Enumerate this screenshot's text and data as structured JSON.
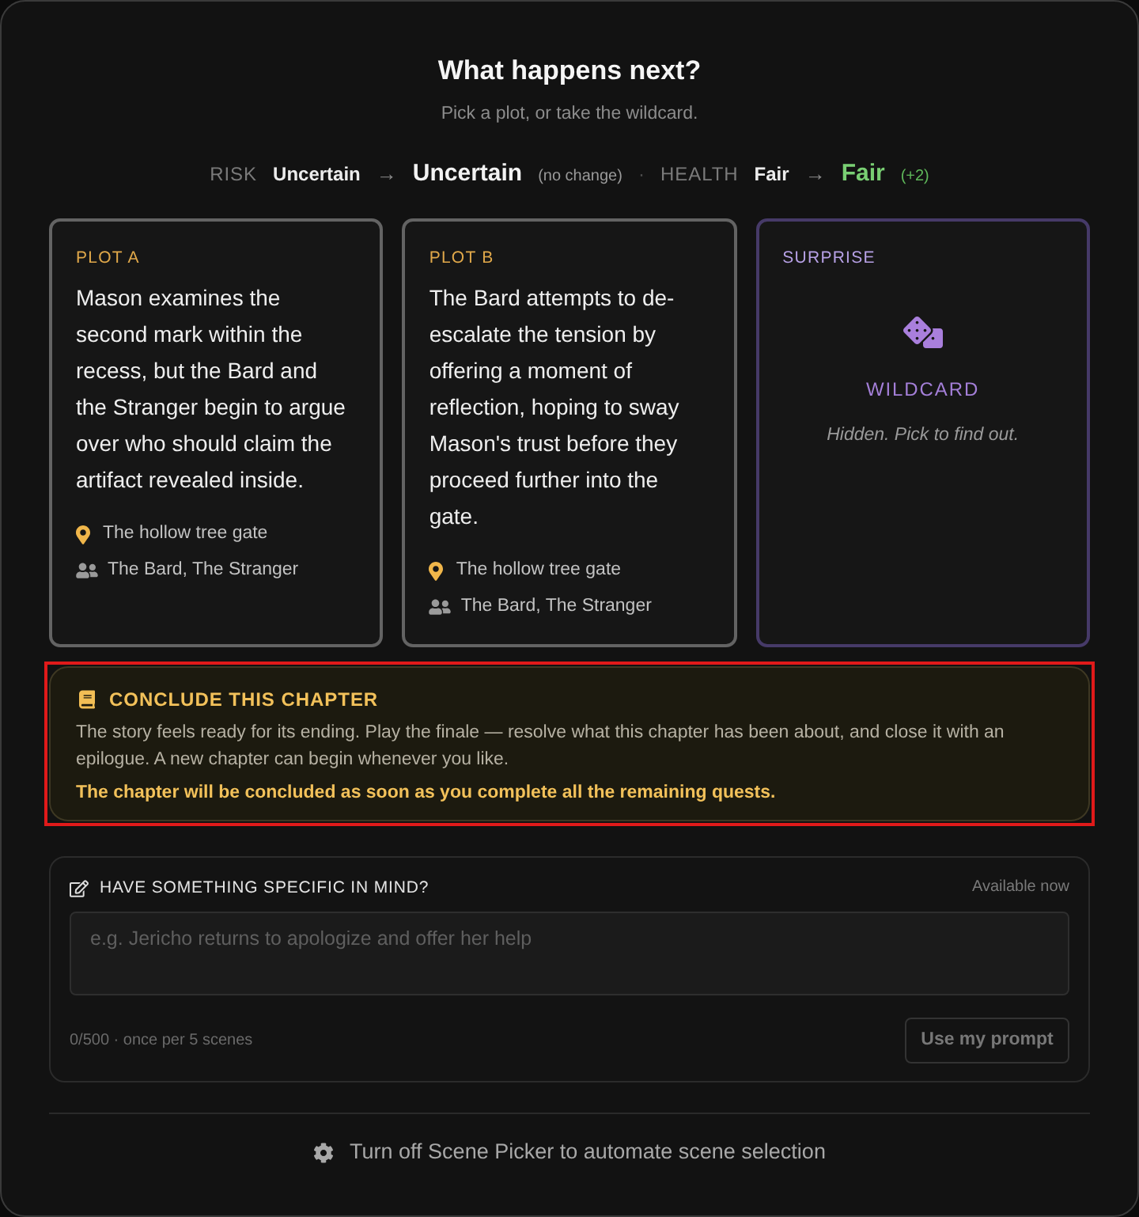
{
  "dialog": {
    "title": "What happens next?",
    "subtitle": "Pick a plot, or take the wildcard."
  },
  "forecast": {
    "separator": "·",
    "items": [
      {
        "kind": "unchanged",
        "label": "RISK",
        "from": "Uncertain",
        "arrow": "→",
        "to": "Uncertain",
        "change": "(no change)"
      },
      {
        "kind": "improved",
        "label": "HEALTH",
        "from": "Fair",
        "arrow": "→",
        "to": "Fair",
        "change": "(+2)"
      }
    ]
  },
  "options": [
    {
      "kind": "plot",
      "label": "PLOT A",
      "text": "Mason examines the second mark within the recess, but the Bard and the Stranger begin to argue over who should claim the artifact revealed inside.",
      "location": "The hollow tree gate",
      "characters": "The Bard, The Stranger",
      "selected": false
    },
    {
      "kind": "plot",
      "label": "PLOT B",
      "text": "The Bard attempts to de-escalate the tension by offering a moment of reflection, hoping to sway Mason's trust before they proceed further into the gate.",
      "location": "The hollow tree gate",
      "characters": "The Bard, The Stranger",
      "selected": false
    },
    {
      "kind": "wildcard",
      "label": "SURPRISE",
      "title": "WILDCARD",
      "hint": "Hidden. Pick to find out.",
      "selected": false
    }
  ],
  "conclude": {
    "title": "CONCLUDE THIS CHAPTER",
    "text": "The story feels ready for its ending. Play the finale — resolve what this chapter has been about, and close it with an epilogue. A new chapter can begin whenever you like.",
    "note": "The chapter will be concluded as soon as you complete all the remaining quests.",
    "highlighted": true
  },
  "custom_prompt": {
    "title": "HAVE SOMETHING SPECIFIC IN MIND?",
    "status": "Available now",
    "placeholder": "e.g. Jericho returns to apologize and offer her help",
    "counter": "0/500 · once per 5 scenes",
    "button": {
      "label": "Use my prompt",
      "disabled": true
    }
  },
  "footer": {
    "link": "Turn off Scene Picker to automate scene selection"
  }
}
